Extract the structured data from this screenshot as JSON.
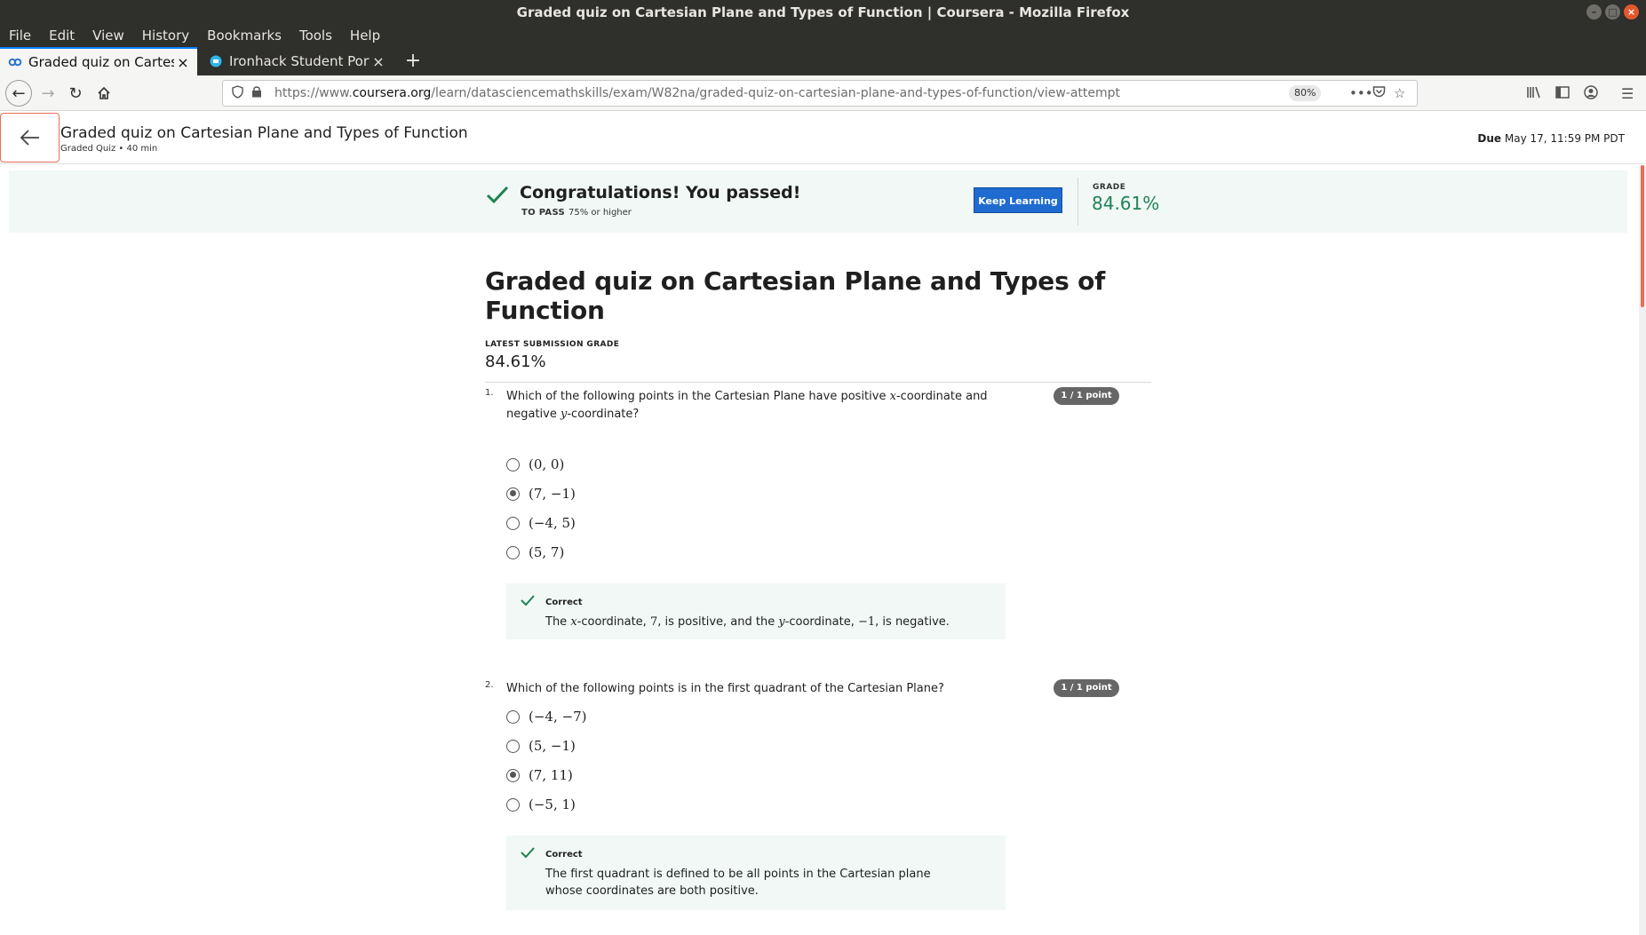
{
  "window": {
    "title": "Graded quiz on Cartesian Plane and Types of Function | Coursera - Mozilla Firefox"
  },
  "menu": [
    "File",
    "Edit",
    "View",
    "History",
    "Bookmarks",
    "Tools",
    "Help"
  ],
  "tabs": [
    {
      "label": "Graded quiz on Cartesian Plane and Types of Function",
      "active": true
    },
    {
      "label": "Ironhack Student Portal",
      "active": false
    }
  ],
  "url": {
    "prefix": "https://www.",
    "domain": "coursera.org",
    "path": "/learn/datasciencemathskills/exam/W82na/graded-quiz-on-cartesian-plane-and-types-of-function/view-attempt",
    "zoom": "80%"
  },
  "header": {
    "title": "Graded quiz on Cartesian Plane and Types of Function",
    "subtitle": "Graded Quiz • 40 min",
    "due_label": "Due",
    "due_value": "May 17, 11:59 PM PDT"
  },
  "banner": {
    "message": "Congratulations! You passed!",
    "to_pass_label": "TO PASS",
    "to_pass_value": "75% or higher",
    "button": "Keep Learning",
    "grade_label": "GRADE",
    "grade_value": "84.61%",
    "accent_color": "#1f8354",
    "button_color": "#1f6bd0"
  },
  "main": {
    "title": "Graded quiz on Cartesian Plane and Types of Function",
    "latest_label": "LATEST SUBMISSION GRADE",
    "latest_value": "84.61%"
  },
  "questions": [
    {
      "number": "1.",
      "text_a": "Which of the following points in the Cartesian Plane have positive ",
      "text_var1": "x",
      "text_b": "-coordinate and negative ",
      "text_var2": "y",
      "text_c": "-coordinate?",
      "points": "1 / 1 point",
      "options": [
        {
          "label": "(0, 0)",
          "selected": false
        },
        {
          "label": "(7, −1)",
          "selected": true
        },
        {
          "label": "(−4, 5)",
          "selected": false
        },
        {
          "label": "(5, 7)",
          "selected": false
        }
      ],
      "feedback_title": "Correct",
      "feedback_a": "The ",
      "feedback_var1": "x",
      "feedback_b": "-coordinate, ",
      "feedback_num1": "7",
      "feedback_c": ", is positive, and the ",
      "feedback_var2": "y",
      "feedback_d": "-coordinate, ",
      "feedback_num2": "−1",
      "feedback_e": ", is negative."
    },
    {
      "number": "2.",
      "text": "Which of the following points is in the first quadrant of the Cartesian Plane?",
      "points": "1 / 1 point",
      "options": [
        {
          "label": "(−4, −7)",
          "selected": false
        },
        {
          "label": "(5, −1)",
          "selected": false
        },
        {
          "label": "(7, 11)",
          "selected": true
        },
        {
          "label": "(−5, 1)",
          "selected": false
        }
      ],
      "feedback_title": "Correct",
      "feedback_text": "The first quadrant is defined to be all points in the Cartesian plane whose coordinates are both positive."
    }
  ],
  "icons": {
    "back": "arrow-left-icon",
    "forward": "arrow-right-icon",
    "reload": "reload-icon",
    "home": "home-icon",
    "check": "check-icon"
  }
}
